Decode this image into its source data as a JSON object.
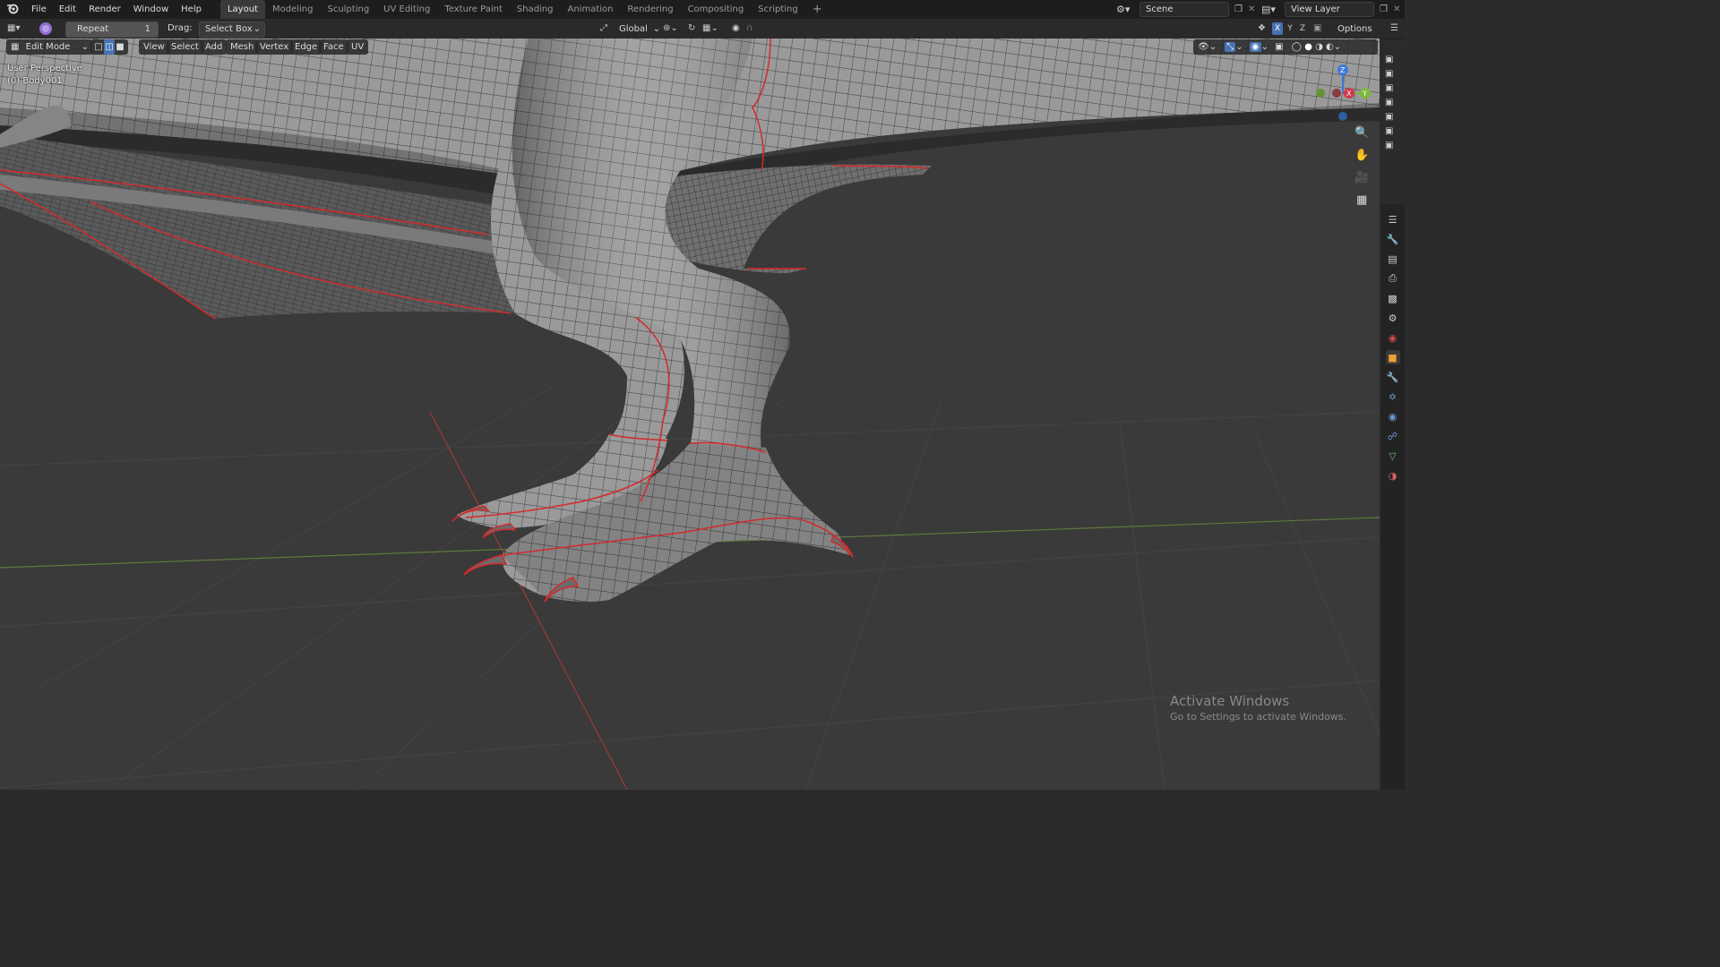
{
  "menu": {
    "items": [
      "File",
      "Edit",
      "Render",
      "Window",
      "Help"
    ]
  },
  "workspaces": [
    "Layout",
    "Modeling",
    "Sculpting",
    "UV Editing",
    "Texture Paint",
    "Shading",
    "Animation",
    "Rendering",
    "Compositing",
    "Scripting"
  ],
  "active_workspace": "Layout",
  "add_workspace": "+",
  "scene": {
    "name": "Scene",
    "view_layer": "View Layer"
  },
  "toolheader": {
    "repeat_label": "Repeat",
    "repeat_count": "1",
    "drag_label": "Drag:",
    "drag_value": "Select Box",
    "orientation": "Global",
    "options": "Options",
    "axes": [
      "X",
      "Y",
      "Z"
    ]
  },
  "viewport_header": {
    "mode": "Edit Mode",
    "menus": [
      "View",
      "Select",
      "Add",
      "Mesh",
      "Vertex",
      "Edge",
      "Face",
      "UV"
    ]
  },
  "overlay": {
    "perspective": "User Perspective",
    "object": "(0) Body001"
  },
  "gizmo": {
    "x": "X",
    "y": "Y",
    "z": "Z"
  },
  "watermark": {
    "title": "Activate Windows",
    "subtitle": "Go to Settings to activate Windows."
  },
  "colors": {
    "seam": "#d42a2a",
    "mesh": "#a9a9a9",
    "grid_x": "#9a3a3a",
    "grid_y": "#5e7a3a",
    "background": "#3a3a3a"
  }
}
